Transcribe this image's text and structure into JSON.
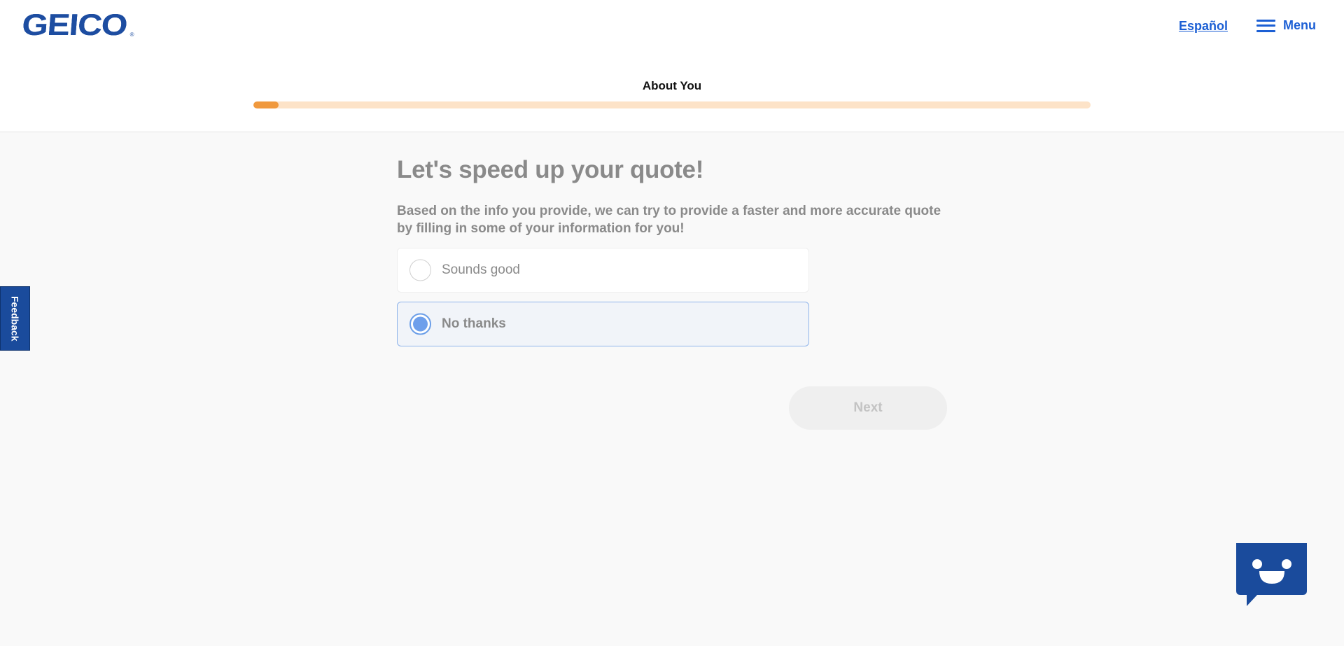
{
  "header": {
    "logo_text": "GEICO",
    "logo_mark": "®",
    "language_link": "Español",
    "menu_label": "Menu"
  },
  "progress": {
    "step_title": "About You",
    "percent": 3
  },
  "main": {
    "heading": "Let's speed up your quote!",
    "description": "Based on the info you provide, we can try to provide a faster and more accurate quote by filling in some of your information for you!",
    "options": [
      {
        "label": "Sounds good",
        "selected": false
      },
      {
        "label": "No thanks",
        "selected": true
      }
    ],
    "next_label": "Next"
  },
  "feedback": {
    "label": "Feedback"
  },
  "colors": {
    "brand": "#1d4da1",
    "link": "#1c5fd4",
    "progress_fill": "#f0993e",
    "progress_track": "#fde3c8",
    "selected_radio": "#6e9feb"
  },
  "icons": {
    "menu": "hamburger-icon",
    "chat": "chat-bot-icon"
  }
}
